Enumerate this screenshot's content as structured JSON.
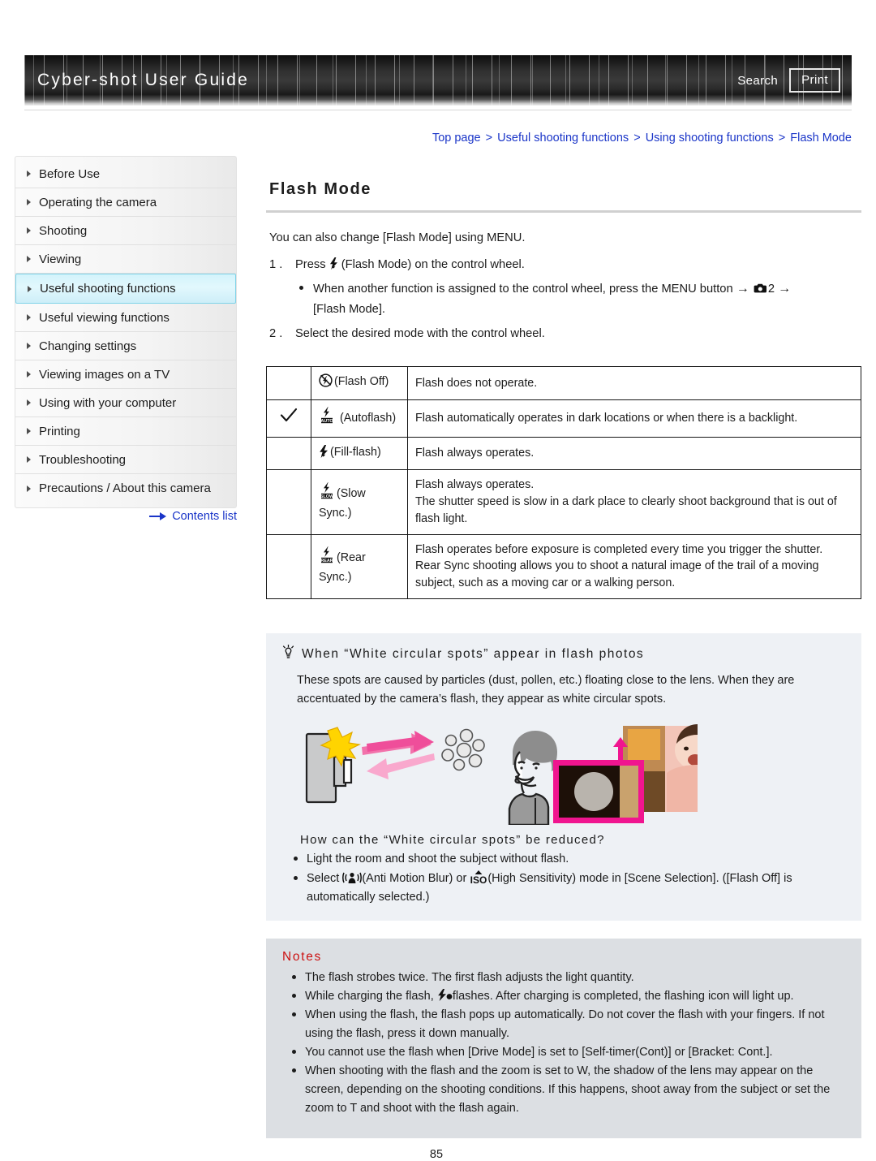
{
  "header": {
    "site_title": "Cyber-shot User Guide",
    "search_label": "Search",
    "print_label": "Print"
  },
  "breadcrumb": {
    "items": [
      "Top page",
      "Useful shooting functions",
      "Using shooting functions",
      "Flash Mode"
    ],
    "separator": ">"
  },
  "sidebar": {
    "items": [
      {
        "label": "Before Use",
        "active": false
      },
      {
        "label": "Operating the camera",
        "active": false
      },
      {
        "label": "Shooting",
        "active": false
      },
      {
        "label": "Viewing",
        "active": false
      },
      {
        "label": "Useful shooting functions",
        "active": true
      },
      {
        "label": "Useful viewing functions",
        "active": false
      },
      {
        "label": "Changing settings",
        "active": false
      },
      {
        "label": "Viewing images on a TV",
        "active": false
      },
      {
        "label": "Using with your computer",
        "active": false
      },
      {
        "label": "Printing",
        "active": false
      },
      {
        "label": "Troubleshooting",
        "active": false
      },
      {
        "label": "Precautions / About this camera",
        "active": false
      }
    ],
    "contents_link": "Contents list"
  },
  "main": {
    "title": "Flash Mode",
    "intro": "You can also change [Flash Mode] using MENU.",
    "step1_pre": "Press",
    "step1_post": "(Flash Mode) on the control wheel.",
    "step1_sub_a": "When another function is assigned to the control wheel, press the MENU button",
    "step1_sub_b": "2",
    "step1_sub_c": "[Flash Mode].",
    "step2": "Select the desired mode with the control wheel.",
    "table": {
      "rows": [
        {
          "checked": false,
          "icon": "flash-off-icon",
          "mode": "(Flash Off)",
          "desc": "Flash does not operate."
        },
        {
          "checked": true,
          "icon": "autoflash-icon",
          "mode": "(Autoflash)",
          "desc": "Flash automatically operates in dark locations or when there is a backlight."
        },
        {
          "checked": false,
          "icon": "fill-flash-icon",
          "mode": "(Fill-flash)",
          "desc": "Flash always operates."
        },
        {
          "checked": false,
          "icon": "slow-sync-icon",
          "mode": "(Slow Sync.)",
          "desc": "Flash always operates.\nThe shutter speed is slow in a dark place to clearly shoot background that is out of flash light."
        },
        {
          "checked": false,
          "icon": "rear-sync-icon",
          "mode": "(Rear Sync.)",
          "desc": "Flash operates before exposure is completed every time you trigger the shutter.\nRear Sync shooting allows you to shoot a natural image of the trail of a moving subject, such as a moving car or a walking person."
        }
      ]
    },
    "tip": {
      "heading": "When “White circular spots” appear in flash photos",
      "body": "These spots are caused by particles (dust, pollen, etc.) floating close to the lens. When they are accentuated by the camera’s flash, they appear as white circular spots.",
      "sub_heading": "How can the “White circular spots” be reduced?",
      "bullets": [
        "Light the room and shoot the subject without flash.",
        "Select  (Anti Motion Blur) or  (High Sensitivity) mode in [Scene Selection]. ([Flash Off] is automatically selected.)"
      ],
      "bullet2_pre": "Select",
      "bullet2_mid": "(Anti Motion Blur) or",
      "bullet2_post": "(High Sensitivity) mode in [Scene Selection]. ([Flash Off] is automatically selected.)"
    },
    "notes": {
      "heading": "Notes",
      "items": [
        "The flash strobes twice. The first flash adjusts the light quantity.",
        "While charging the flash,  flashes. After charging is completed, the flashing icon will light up.",
        "When using the flash, the flash pops up automatically. Do not cover the flash with your fingers. If not using the flash, press it down manually.",
        "You cannot use the flash when [Drive Mode] is set to [Self-timer(Cont)] or [Bracket: Cont.].",
        "When shooting with the flash and the zoom is set to W, the shadow of the lens may appear on the screen, depending on the shooting conditions. If this happens, shoot away from the subject or set the zoom to T and shoot with the flash again."
      ],
      "note2_pre": "While charging the flash,",
      "note2_post": "flashes. After charging is completed, the flashing icon will light up."
    },
    "page_number": "85"
  },
  "colors": {
    "link": "#1a35c8",
    "notes_heading": "#cc1111",
    "active_nav": "#d3f3fb",
    "tip_bg": "#eef1f5",
    "notes_bg": "#dcdfe3",
    "magenta": "#f0158f"
  }
}
